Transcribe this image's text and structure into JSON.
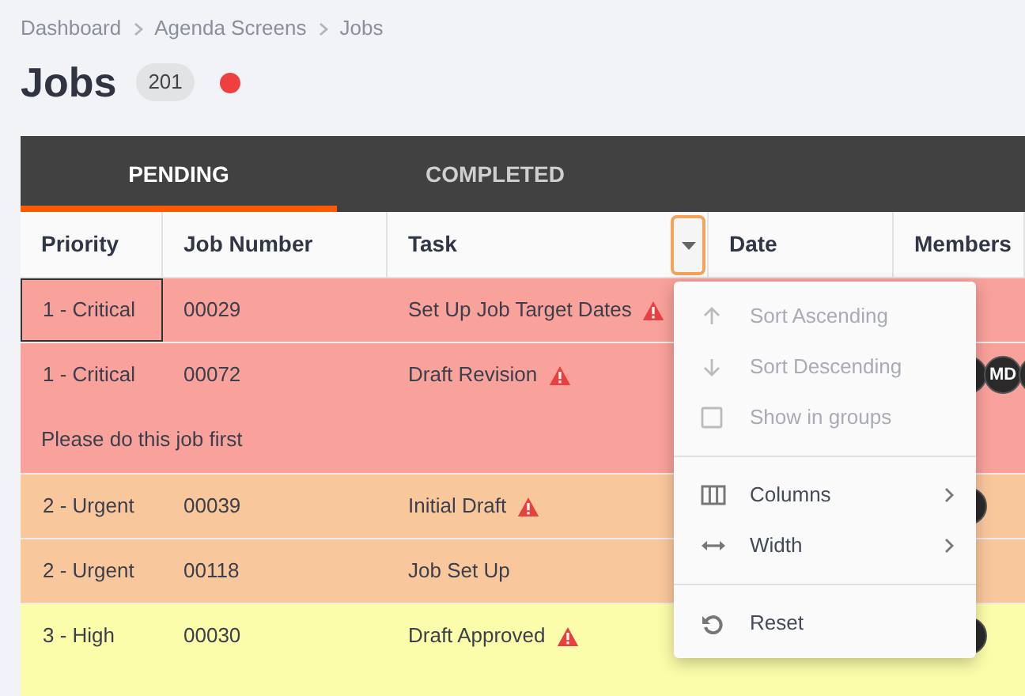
{
  "breadcrumb": [
    "Dashboard",
    "Agenda Screens",
    "Jobs"
  ],
  "title": "Jobs",
  "count": "201",
  "alert_dot": true,
  "tabs": [
    {
      "label": "PENDING",
      "selected": true
    },
    {
      "label": "COMPLETED",
      "selected": false
    }
  ],
  "columns": [
    {
      "label": "Priority",
      "menu_open": false
    },
    {
      "label": "Job Number",
      "menu_open": false
    },
    {
      "label": "Task",
      "menu_open": true
    },
    {
      "label": "Date",
      "menu_open": false
    },
    {
      "label": "Members",
      "menu_open": false
    }
  ],
  "rows": [
    {
      "priority": "1 - Critical",
      "color": "#f9a19b",
      "job": "00029",
      "task": "Set Up Job Target Dates",
      "warning": true,
      "focused": true,
      "members": []
    },
    {
      "priority": "1 - Critical",
      "color": "#f9a19b",
      "job": "00072",
      "task": "Draft Revision",
      "warning": true,
      "focused": false,
      "note": "Please do this job first",
      "members": [
        {
          "kind": "covered"
        },
        {
          "kind": "initials",
          "text": "MD"
        },
        {
          "kind": "covered"
        }
      ]
    },
    {
      "priority": "2 - Urgent",
      "color": "#f9c79c",
      "job": "00039",
      "task": "Initial Draft",
      "warning": true,
      "focused": false,
      "members": [
        {
          "kind": "covered"
        }
      ]
    },
    {
      "priority": "2 - Urgent",
      "color": "#f9c79c",
      "job": "00118",
      "task": "Job Set Up",
      "warning": false,
      "focused": false,
      "members": []
    },
    {
      "priority": "3 - High",
      "color": "#fcfdaa",
      "job": "00030",
      "task": "Draft Approved",
      "warning": true,
      "focused": false,
      "members": [
        {
          "kind": "covered"
        }
      ]
    }
  ],
  "menu": {
    "groups": [
      [
        {
          "kind": "sort-ascending",
          "label": "Sort Ascending",
          "disabled": true,
          "submenu": false
        },
        {
          "kind": "sort-descending",
          "label": "Sort Descending",
          "disabled": true,
          "submenu": false
        },
        {
          "kind": "toggle",
          "label": "Show in groups",
          "disabled": true,
          "submenu": false
        }
      ],
      [
        {
          "kind": "columns",
          "label": "Columns",
          "disabled": false,
          "submenu": true
        },
        {
          "kind": "width",
          "label": "Width",
          "disabled": false,
          "submenu": true
        }
      ],
      [
        {
          "kind": "reset",
          "label": "Reset",
          "disabled": false,
          "submenu": false
        }
      ]
    ]
  }
}
